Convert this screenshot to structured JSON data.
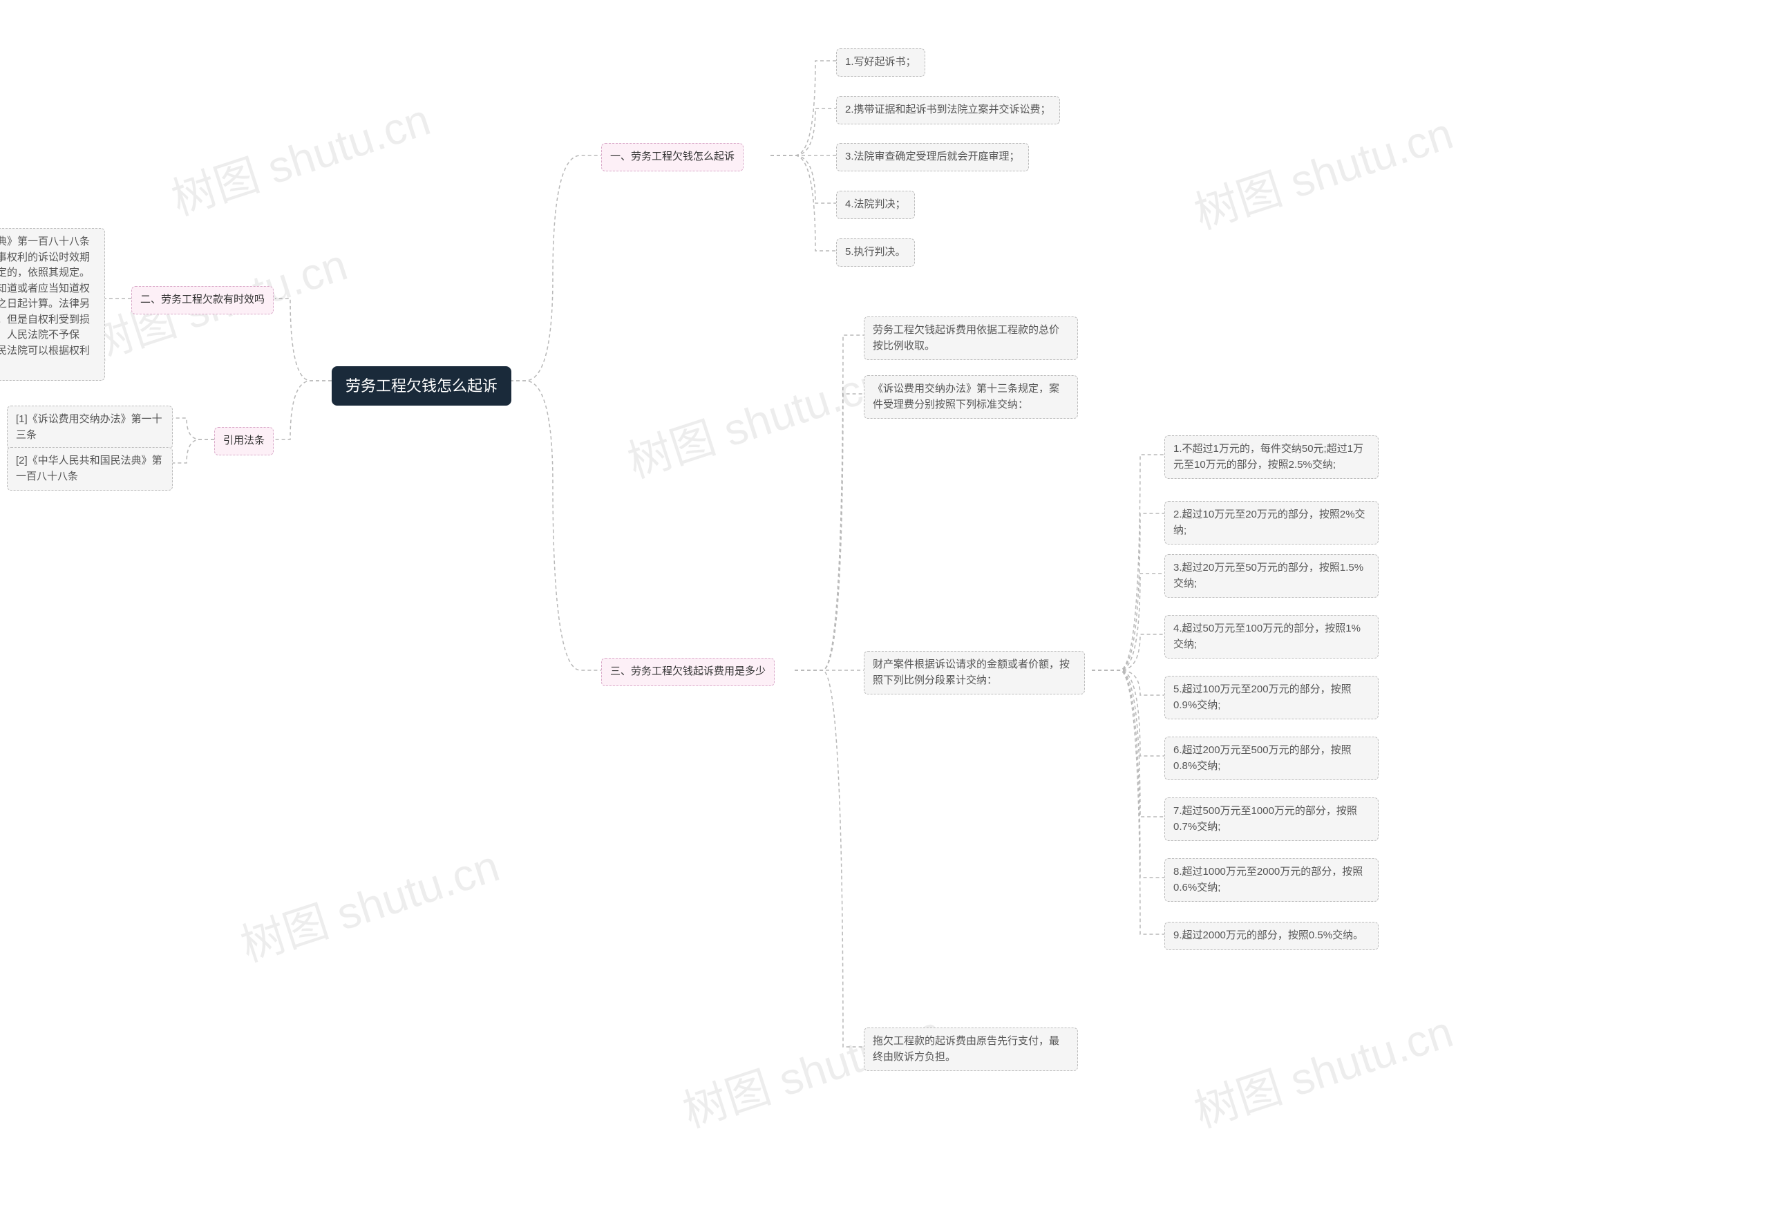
{
  "root": {
    "title": "劳务工程欠钱怎么起诉"
  },
  "section1": {
    "title": "一、劳务工程欠钱怎么起诉",
    "items": [
      "1.写好起诉书；",
      "2.携带证据和起诉书到法院立案并交诉讼费；",
      "3.法院审查确定受理后就会开庭审理；",
      "4.法院判决；",
      "5.执行判决。"
    ]
  },
  "section2": {
    "title": "二、劳务工程欠款有时效吗",
    "detail": "《中华人民共和国民法典》第一百八十八条 向人民法院请求保护民事权利的诉讼时效期间为三年。法律另有规定的，依照其规定。诉讼时效期间自权利人知道或者应当知道权利受到损害以及义务人之日起计算。法律另有规定的，依照其规定。但是自权利受到损害之日起超过二十年的，人民法院不予保护；有特殊情况的，人民法院可以根据权利人的申请决定延长。"
  },
  "section3": {
    "title": "三、劳务工程欠钱起诉费用是多少",
    "intro1": "劳务工程欠钱起诉费用依据工程款的总价按比例收取。",
    "intro2": "《诉讼费用交纳办法》第十三条规定，案件受理费分别按照下列标准交纳：",
    "ruleTitle": "财产案件根据诉讼请求的金额或者价额，按照下列比例分段累计交纳：",
    "rules": [
      "1.不超过1万元的，每件交纳50元;超过1万元至10万元的部分，按照2.5%交纳;",
      "2.超过10万元至20万元的部分，按照2%交纳;",
      "3.超过20万元至50万元的部分，按照1.5%交纳;",
      "4.超过50万元至100万元的部分，按照1%交纳;",
      "5.超过100万元至200万元的部分，按照0.9%交纳;",
      "6.超过200万元至500万元的部分，按照0.8%交纳;",
      "7.超过500万元至1000万元的部分，按照0.7%交纳;",
      "8.超过1000万元至2000万元的部分，按照0.6%交纳;",
      "9.超过2000万元的部分，按照0.5%交纳。"
    ],
    "footer": "拖欠工程款的起诉费由原告先行支付，最终由败诉方负担。"
  },
  "refs": {
    "title": "引用法条",
    "items": [
      "[1]《诉讼费用交纳办法》第一十三条",
      "[2]《中华人民共和国民法典》第一百八十八条"
    ]
  },
  "watermark": "树图 shutu.cn"
}
